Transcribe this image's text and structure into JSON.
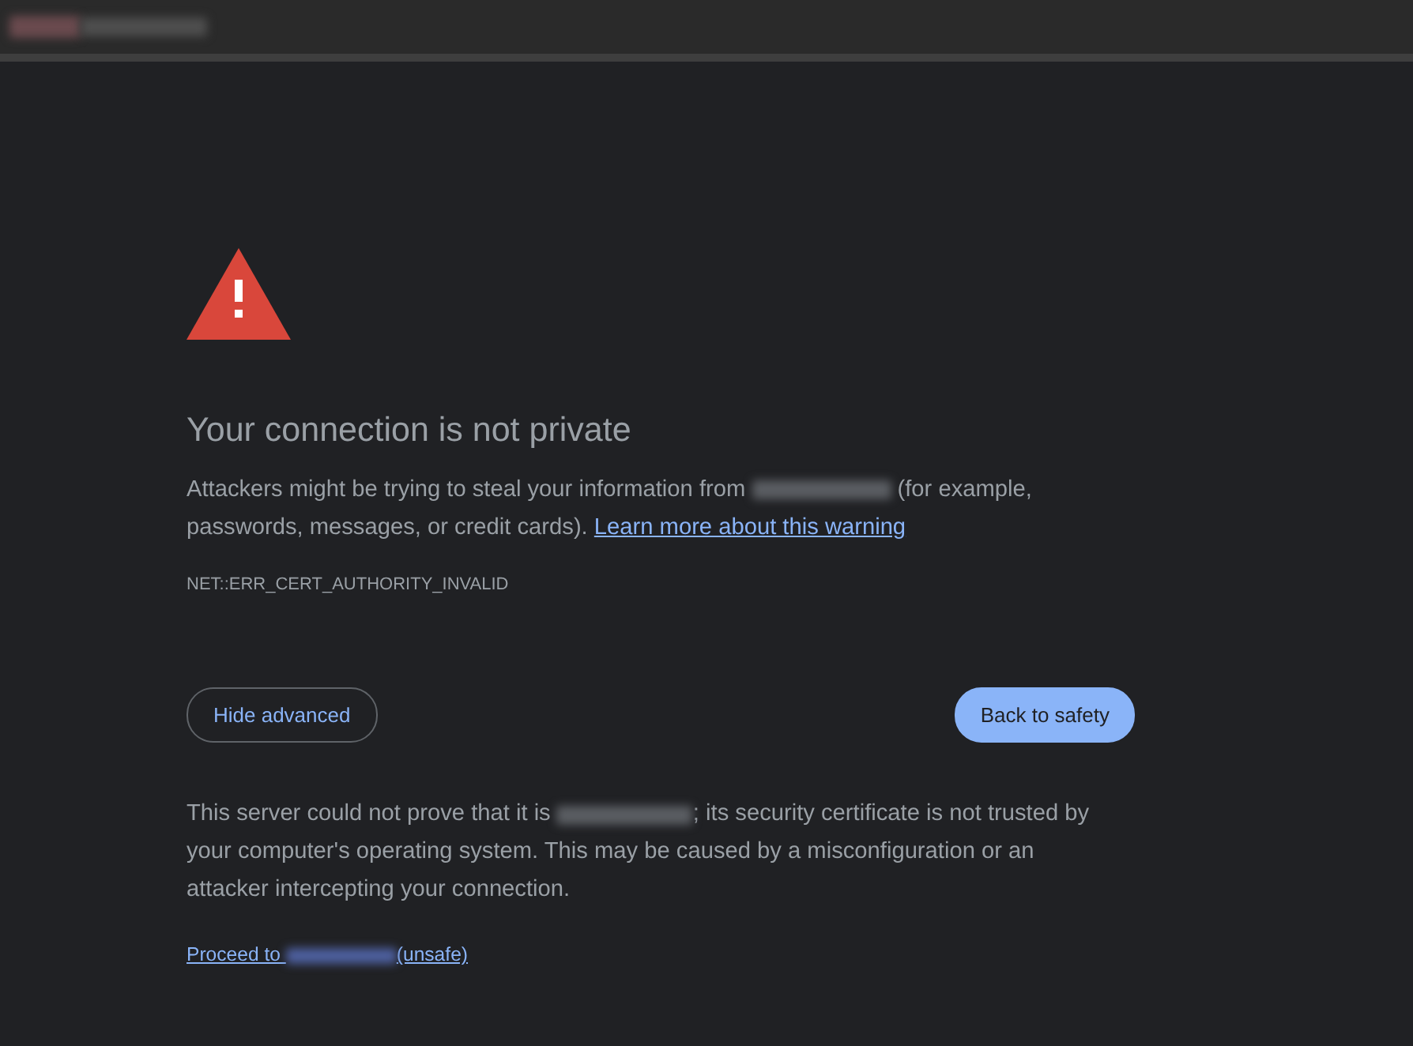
{
  "heading": "Your connection is not private",
  "intro": {
    "before": "Attackers might be trying to steal your information from",
    "after": "(for example, passwords, messages, or credit cards).",
    "link": "Learn more about this warning"
  },
  "error_code": "NET::ERR_CERT_AUTHORITY_INVALID",
  "buttons": [
    {
      "label": "Hide advanced",
      "kind": "outline"
    },
    {
      "label": "Back to safety",
      "kind": "primary"
    }
  ],
  "details": {
    "before": "This server could not prove that it is",
    "after": "; its security certificate is not trusted by your computer's operating system. This may be caused by a misconfiguration or an attacker intercepting your connection."
  },
  "proceed_link": {
    "before": "Proceed to",
    "after": "(unsafe)"
  }
}
